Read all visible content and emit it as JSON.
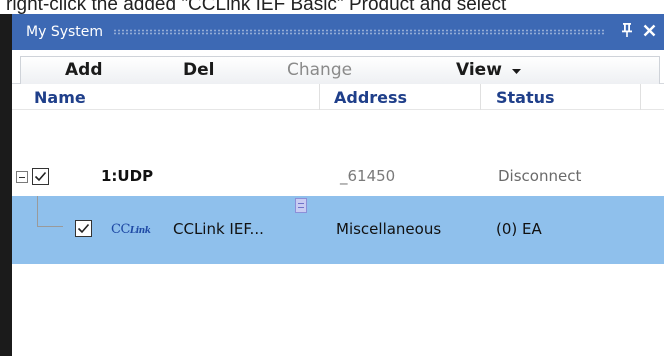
{
  "instruction": {
    "text": "right-click the added \"CCLink IEF Basic\" Product and select"
  },
  "panel": {
    "title": "My System",
    "pin_icon": "pin-icon",
    "close_icon": "close-icon"
  },
  "toolbar": {
    "add_label": "Add",
    "del_label": "Del",
    "change_label": "Change",
    "view_label": "View",
    "view_dropdown_icon": "chevron-down-icon"
  },
  "columns": {
    "name": "Name",
    "address": "Address",
    "status": "Status"
  },
  "tree": [
    {
      "name": "1:UDP",
      "address": "_61450",
      "status": "Disconnect",
      "checked": true,
      "expanded": true
    },
    {
      "logo_text": "CC",
      "logo_text_2": "Link",
      "name": "CCLink IEF...",
      "address": "Miscellaneous",
      "status": "(0) EA",
      "checked": true,
      "selected": true
    }
  ],
  "colors": {
    "titlebar": "#3d69b4",
    "selection": "#8fc0ec",
    "header_text": "#1f3f8a"
  }
}
